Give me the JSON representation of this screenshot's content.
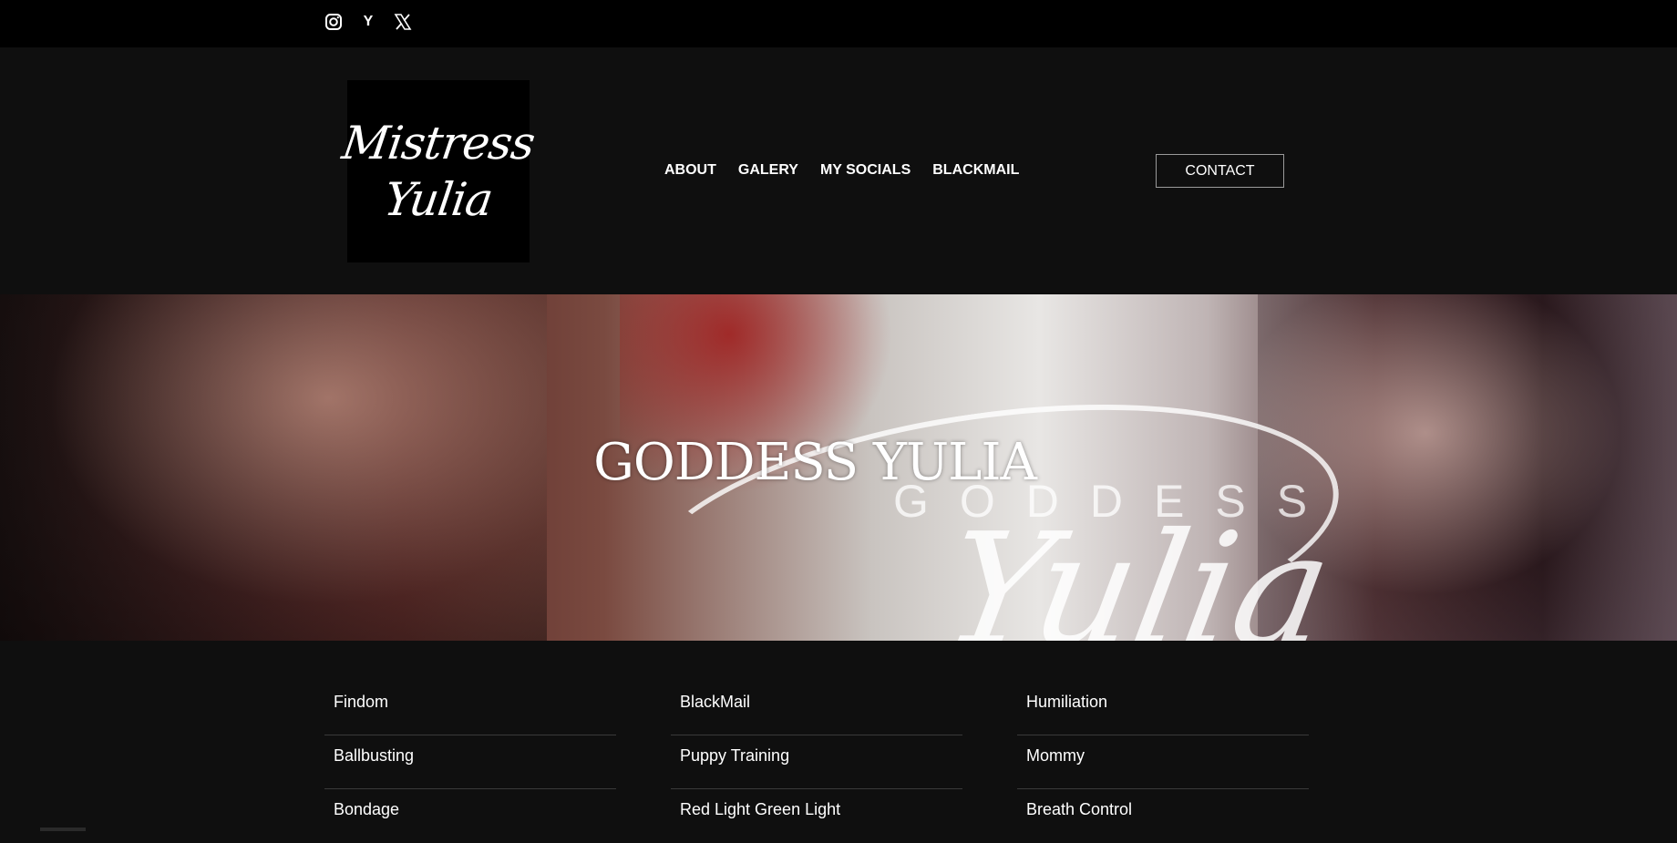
{
  "topbar": {
    "social_icons": [
      {
        "name": "instagram-icon"
      },
      {
        "name": "y-icon",
        "glyph": "Y"
      },
      {
        "name": "x-icon",
        "glyph": "𝕏"
      }
    ]
  },
  "header": {
    "logo": {
      "line1": "Mistress",
      "line2": "Yulia"
    },
    "nav": [
      "ABOUT",
      "GALERY",
      "MY SOCIALS",
      "BLACKMAIL"
    ],
    "contact_label": "CONTACT"
  },
  "hero": {
    "title": "GODDESS YULIA",
    "watermark": "GODDESS",
    "script": "Yulia"
  },
  "categories": {
    "col1": [
      "Findom",
      "Ballbusting",
      "Bondage"
    ],
    "col2": [
      "BlackMail",
      "Puppy Training",
      "Red Light Green Light"
    ],
    "col3": [
      "Humiliation",
      "Mommy",
      "Breath Control"
    ]
  },
  "colors": {
    "page_bg": "#0f0f0f",
    "topbar_bg": "#000000",
    "text": "#ffffff",
    "divider": "#3a3a3a"
  }
}
